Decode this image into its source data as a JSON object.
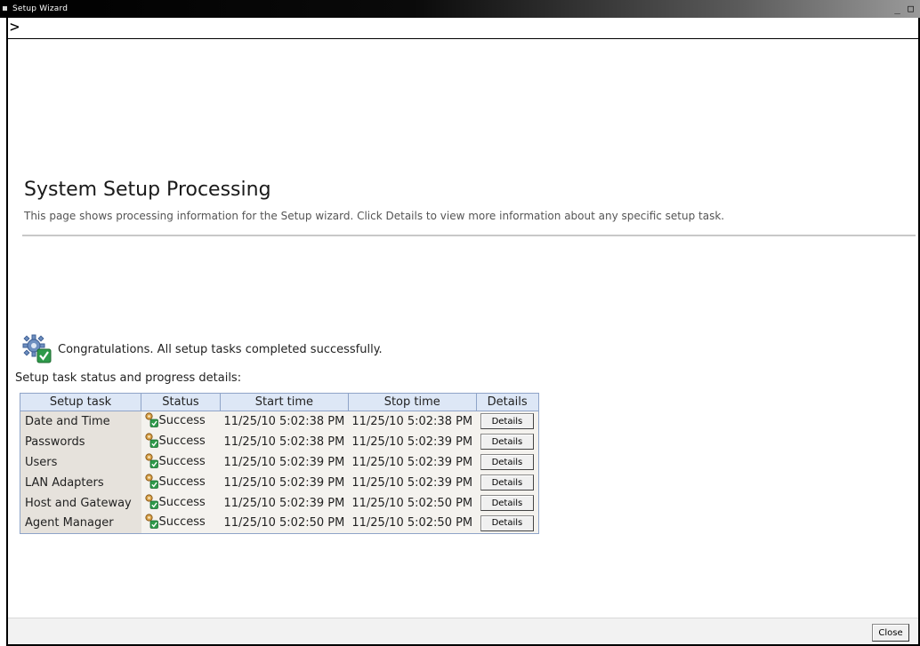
{
  "window": {
    "title": "Setup Wizard",
    "minimize_glyph": "_",
    "maximize_glyph": "□",
    "prompt": ">"
  },
  "page": {
    "title": "System Setup Processing",
    "description": "This page shows processing information for the Setup wizard. Click Details to view more information about any specific setup task."
  },
  "status": {
    "message": "Congratulations. All setup tasks completed successfully.",
    "icon": "gear-check-icon",
    "subheading": "Setup task status and progress details:"
  },
  "table": {
    "headers": [
      "Setup task",
      "Status",
      "Start time",
      "Stop time",
      "Details"
    ],
    "rows": [
      {
        "task": "Date and Time",
        "status": "Success",
        "start": "11/25/10 5:02:38 PM",
        "stop": "11/25/10 5:02:38 PM",
        "details": "Details"
      },
      {
        "task": "Passwords",
        "status": "Success",
        "start": "11/25/10 5:02:38 PM",
        "stop": "11/25/10 5:02:39 PM",
        "details": "Details"
      },
      {
        "task": "Users",
        "status": "Success",
        "start": "11/25/10 5:02:39 PM",
        "stop": "11/25/10 5:02:39 PM",
        "details": "Details"
      },
      {
        "task": "LAN Adapters",
        "status": "Success",
        "start": "11/25/10 5:02:39 PM",
        "stop": "11/25/10 5:02:39 PM",
        "details": "Details"
      },
      {
        "task": "Host and Gateway",
        "status": "Success",
        "start": "11/25/10 5:02:39 PM",
        "stop": "11/25/10 5:02:50 PM",
        "details": "Details"
      },
      {
        "task": "Agent Manager",
        "status": "Success",
        "start": "11/25/10 5:02:50 PM",
        "stop": "11/25/10 5:02:50 PM",
        "details": "Details"
      }
    ]
  },
  "footer": {
    "close_label": "Close"
  },
  "colors": {
    "success": "#2e9a4a",
    "header_bg": "#dde7f6",
    "table_border": "#8fa4c8"
  }
}
